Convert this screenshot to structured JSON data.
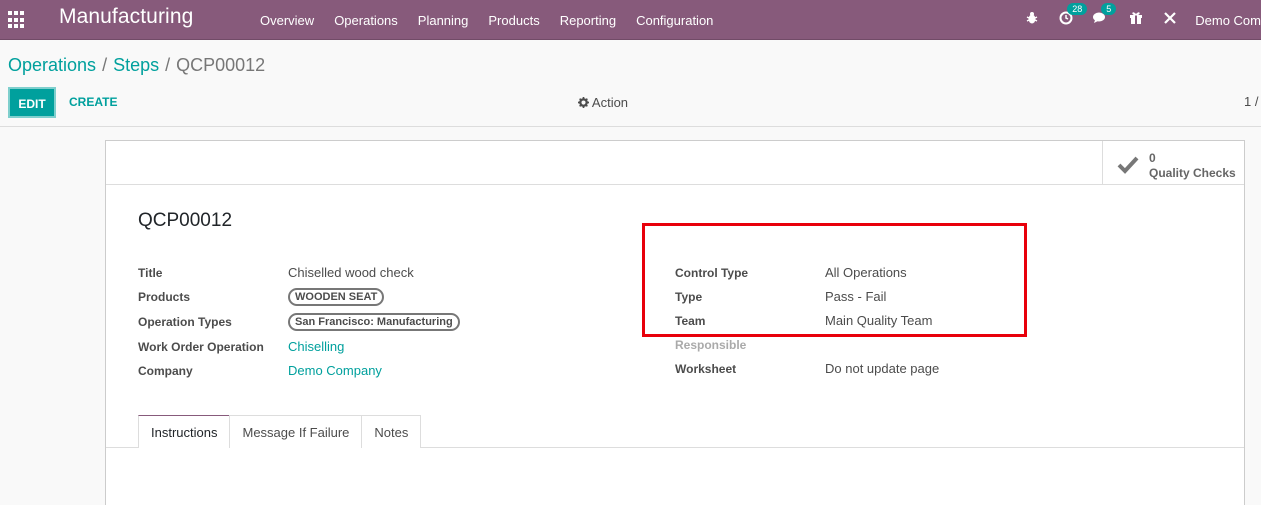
{
  "navbar": {
    "app_name": "Manufacturing",
    "menu": [
      "Overview",
      "Operations",
      "Planning",
      "Products",
      "Reporting",
      "Configuration"
    ],
    "activity_badge": "28",
    "messages_badge": "5",
    "user": "Demo Com"
  },
  "breadcrumb": {
    "level1": "Operations",
    "level2": "Steps",
    "current": "QCP00012",
    "separator": "/"
  },
  "toolbar": {
    "edit_label": "EDIT",
    "create_label": "CREATE",
    "action_label": "Action",
    "pager": "1 /"
  },
  "stat_button": {
    "value": "0",
    "label": "Quality Checks"
  },
  "record": {
    "name": "QCP00012",
    "left_fields": [
      {
        "label": "Title",
        "value": "Chiselled wood check"
      },
      {
        "label": "Products",
        "value": "WOODEN SEAT"
      },
      {
        "label": "Operation Types",
        "value": "San Francisco: Manufacturing"
      },
      {
        "label": "Work Order Operation",
        "value": "Chiselling"
      },
      {
        "label": "Company",
        "value": "Demo Company"
      }
    ],
    "right_fields": [
      {
        "label": "Control Type",
        "value": "All Operations"
      },
      {
        "label": "Type",
        "value": "Pass - Fail"
      },
      {
        "label": "Team",
        "value": "Main Quality Team"
      },
      {
        "label": "Responsible",
        "value": ""
      },
      {
        "label": "Worksheet",
        "value": "Do not update page"
      }
    ]
  },
  "tabs": [
    "Instructions",
    "Message If Failure",
    "Notes"
  ],
  "colors": {
    "navbar": "#875a7b",
    "accent": "#00a09d",
    "highlight": "#e8000b"
  }
}
